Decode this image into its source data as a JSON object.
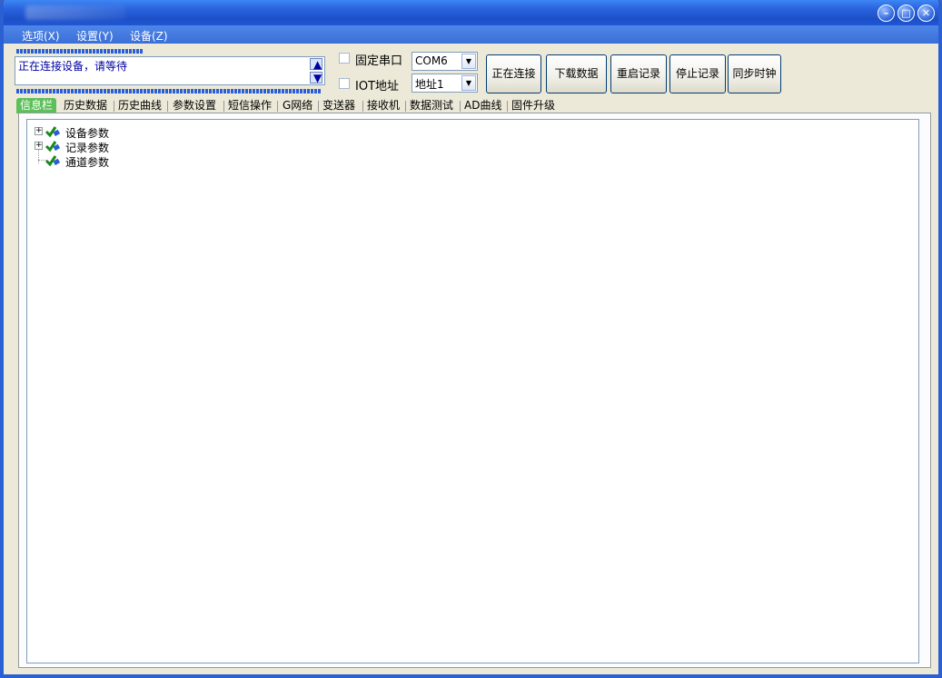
{
  "menu": {
    "options": "选项(X)",
    "settings": "设置(Y)",
    "device": "设备(Z)"
  },
  "status": {
    "message": "正在连接设备，请等待"
  },
  "controls": {
    "fixed_port_label": "固定串口",
    "iot_address_label": "IOT地址",
    "port_value": "COM6",
    "address_value": "地址1"
  },
  "buttons": {
    "connect": "正在连接",
    "download": "下载数据",
    "restart_record": "重启记录",
    "stop_record": "停止记录",
    "sync_clock": "同步时钟"
  },
  "tabs": [
    "信息栏",
    "历史数据",
    "历史曲线",
    "参数设置",
    "短信操作",
    "G网络",
    "变送器",
    "接收机",
    "数据测试",
    "AD曲线",
    "固件升级"
  ],
  "tree": {
    "items": [
      "设备参数",
      "记录参数",
      "通道参数"
    ]
  },
  "colors": {
    "titlebar": "#2a63dc",
    "active_tab": "#5dbf59",
    "status_text": "#0000a0"
  }
}
